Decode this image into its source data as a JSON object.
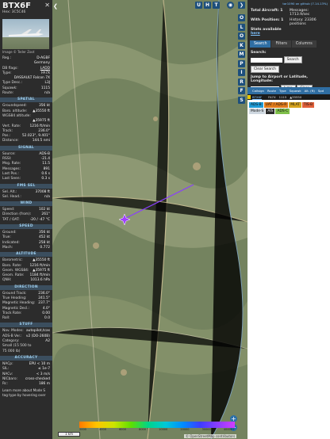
{
  "aircraft": {
    "callsign": "BTX6F",
    "hex_label": "Hex: 3C5C46",
    "photo_credit": "Image © Teder Zoot"
  },
  "info_rows": [
    {
      "k": "Reg.:",
      "v": "D-AGBF"
    },
    {
      "k": "",
      "v": "Germany"
    },
    {
      "k": "DB flags:",
      "v": "LADD"
    },
    {
      "k": "Type:",
      "v": "FA7X"
    },
    {
      "k": "",
      "v": "DASSAULT Falcon 7X"
    },
    {
      "k": "Type Desc.:",
      "v": "L3J"
    },
    {
      "k": "Squawk:",
      "v": "1115"
    },
    {
      "k": "Route:",
      "v": "n/a"
    }
  ],
  "sections": {
    "spatial": "SPATIAL",
    "signal": "SIGNAL",
    "fms": "FMS SEL",
    "wind": "WIND",
    "speed": "SPEED",
    "altitude": "ALTITUDE",
    "direction": "DIRECTION",
    "stuff": "STUFF",
    "accuracy": "ACCURACY"
  },
  "spatial_rows": [
    {
      "k": "Groundspeed:",
      "v": "356 kt"
    },
    {
      "k": "Baro. altitude:",
      "v": "▲35550 ft"
    },
    {
      "k": "WGS84 altitude:",
      "v": ""
    },
    {
      "k": "",
      "v": "▲35975 ft"
    },
    {
      "k": "Vert. Rate:",
      "v": "1216 ft/min"
    },
    {
      "k": "Track:",
      "v": "236.0°"
    },
    {
      "k": "Pos.:",
      "v": "52.023°, 9.401°"
    },
    {
      "k": "Distance:",
      "v": "144.5 nmi"
    }
  ],
  "signal_rows": [
    {
      "k": "Source:",
      "v": "ADS-B"
    },
    {
      "k": "RSSI:",
      "v": "-21.4"
    },
    {
      "k": "Msg. Rate:",
      "v": "11.5"
    },
    {
      "k": "Messages:",
      "v": "891"
    },
    {
      "k": "Last Pos.:",
      "v": "0.6 s"
    },
    {
      "k": "Last Seen:",
      "v": "0.3 s"
    }
  ],
  "fms_rows": [
    {
      "k": "Sel. Alt.:",
      "v": "37008 ft"
    },
    {
      "k": "Sel. Head.:",
      "v": "n/a"
    }
  ],
  "wind_rows": [
    {
      "k": "Speed:",
      "v": "102 kt"
    },
    {
      "k": "Direction (from):",
      "v": "261°"
    },
    {
      "k": "TAT / OAT:",
      "v": "-20 / -47 °C"
    }
  ],
  "speed_rows": [
    {
      "k": "Ground:",
      "v": "356 kt"
    },
    {
      "k": "True:",
      "v": "452 kt"
    },
    {
      "k": "Indicated:",
      "v": "258 kt"
    },
    {
      "k": "Mach:",
      "v": "0.772"
    }
  ],
  "altitude_rows": [
    {
      "k": "Barometric:",
      "v": "▲35550 ft"
    },
    {
      "k": "Baro. Rate:",
      "v": "1216 ft/min"
    },
    {
      "k": "Geom. WGS84:",
      "v": "▲35975 ft"
    },
    {
      "k": "Geom. Rate:",
      "v": "1184 ft/min"
    },
    {
      "k": "QNH:",
      "v": "1013.6 hPa"
    }
  ],
  "direction_rows": [
    {
      "k": "Ground Track:",
      "v": "236.0°"
    },
    {
      "k": "True Heading:",
      "v": "241.5°"
    },
    {
      "k": "Magnetic Heading:",
      "v": "237.7°"
    },
    {
      "k": "Magnetic Decl.:",
      "v": "4.0°"
    },
    {
      "k": "Track Rate:",
      "v": "0.00"
    },
    {
      "k": "Roll:",
      "v": "0.0"
    }
  ],
  "stuff_rows": [
    {
      "k": "Nav. Modes:",
      "v": "autopilot,tcas"
    },
    {
      "k": "ADS-B Ver.:",
      "v": "v2 (DO-260B)"
    },
    {
      "k": "Category:",
      "v": "A2"
    },
    {
      "k": "Small (15 500 to",
      "v": ""
    },
    {
      "k": "75 000 lb)",
      "v": ""
    }
  ],
  "accuracy_rows": [
    {
      "k": "NACp:",
      "v": "EPU < 10 m"
    },
    {
      "k": "SIL:",
      "v": "≤ 1e-7"
    },
    {
      "k": "NACv:",
      "v": "< 3 m/s"
    },
    {
      "k": "NICbaro:",
      "v": "cross-checked"
    },
    {
      "k": "Rc:",
      "v": "186 m"
    }
  ],
  "footnote": "Learn more about Mode S tag type by hovering over",
  "map": {
    "top_buttons": [
      "U",
      "H",
      "T"
    ],
    "side_buttons": [
      "O",
      "L",
      "O",
      "K",
      "M",
      "P",
      "I",
      "R",
      "F",
      "S"
    ],
    "scale_label": "1 km",
    "color_labels": [
      "2000",
      "4000",
      "6000",
      "8000",
      "10000",
      "20000",
      "30000",
      "40000+"
    ],
    "attribution": "© OpenStreetMap contributors"
  },
  "right": {
    "version": "tar1090 on github (7.14.13%)",
    "total_aircraft_label": "Total Aircraft: 1",
    "messages_label": "Messages: 1713.9/sec",
    "with_position_label": "With Position: 1",
    "history_label": "History: 23306 positions",
    "stats_label": "Stats available",
    "stats_link": "here",
    "tabs": [
      "Search",
      "Filters",
      "Columns"
    ],
    "search_label": "Search:",
    "search_button": "Search",
    "clear_search": "Clear Search",
    "jump_label": "Jump to Airport or Latitude, Longitude:",
    "jump_button": "Jump",
    "clear_button": "Clear",
    "table_headers": [
      "",
      "Callsign",
      "Route",
      "Type",
      "Squawk",
      "Alt. (ft)",
      "Spd"
    ],
    "table_row": [
      "",
      "BTX6F",
      "",
      "FA7X",
      "1115",
      "▲35550",
      ""
    ],
    "badges": [
      "ADS-B",
      "UAT / ADS-R",
      "MLAT",
      "TIS-B",
      "Mode-S",
      "AIS",
      "ADS-C"
    ],
    "badge_colors": [
      "#1f9bd6",
      "#e07b1c",
      "#d6a31f",
      "#e0603a",
      "#cfd8e0",
      "#2b2b2b",
      "#7fbf4a"
    ]
  }
}
